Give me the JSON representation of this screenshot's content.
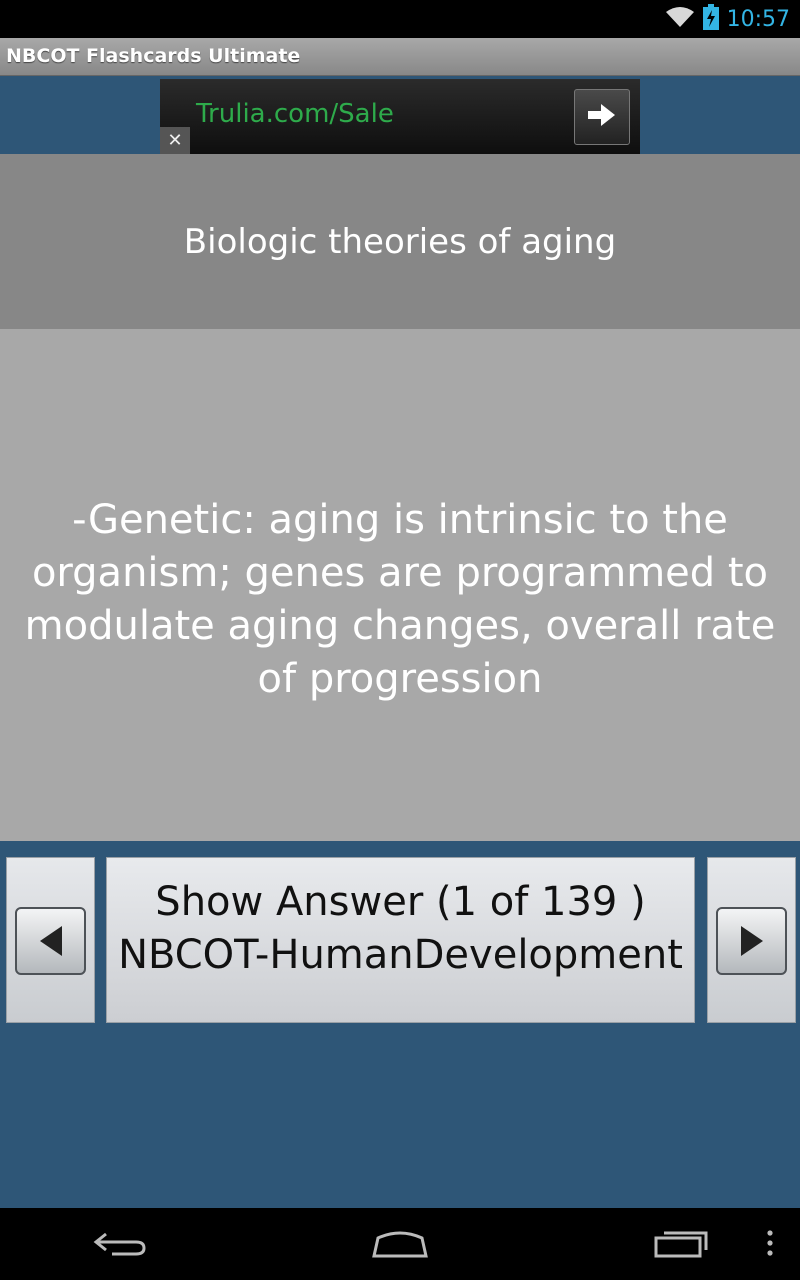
{
  "status_bar": {
    "time": "10:57",
    "icons": [
      "wifi-icon",
      "battery-charging-icon"
    ]
  },
  "app": {
    "title": "NBCOT Flashcards Ultimate"
  },
  "ad": {
    "text": "Trulia.com/Sale",
    "close_label": "✕",
    "text_color": "#2eab4b"
  },
  "card": {
    "question": "Biologic theories of aging",
    "answer": "-Genetic: aging is intrinsic to the organism; genes are programmed to modulate aging changes, overall rate of progression"
  },
  "controls": {
    "show_answer_label": "Show Answer  (1 of 139 )",
    "deck_name": "NBCOT-HumanDevelopment",
    "prev_icon": "left-arrow-icon",
    "next_icon": "right-arrow-icon"
  },
  "nav_bar": {
    "icons": [
      "back-icon",
      "home-icon",
      "recent-apps-icon",
      "overflow-menu-icon"
    ]
  },
  "colors": {
    "background": "#2e5677",
    "question_bg": "#878787",
    "answer_bg": "#a8a8a8",
    "clock": "#33b5e5"
  }
}
